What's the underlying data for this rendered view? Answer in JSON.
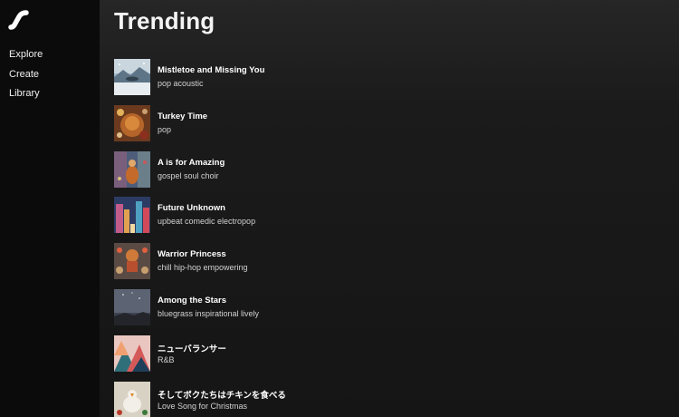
{
  "sidebar": {
    "logo_icon": "suno-wave-logo",
    "items": [
      {
        "label": "Explore"
      },
      {
        "label": "Create"
      },
      {
        "label": "Library"
      }
    ]
  },
  "main": {
    "title": "Trending",
    "songs": [
      {
        "title": "Mistletoe and Missing You",
        "tags": "pop acoustic"
      },
      {
        "title": "Turkey Time",
        "tags": "pop"
      },
      {
        "title": "A is for Amazing",
        "tags": "gospel soul choir"
      },
      {
        "title": "Future Unknown",
        "tags": "upbeat comedic electropop"
      },
      {
        "title": "Warrior Princess",
        "tags": "chill hip-hop empowering"
      },
      {
        "title": "Among the Stars",
        "tags": "bluegrass inspirational lively"
      },
      {
        "title": "ニューバランサー",
        "tags": "R&B"
      },
      {
        "title": "そしてボクたちはチキンを食べる",
        "tags": "Love Song for Christmas"
      }
    ]
  }
}
